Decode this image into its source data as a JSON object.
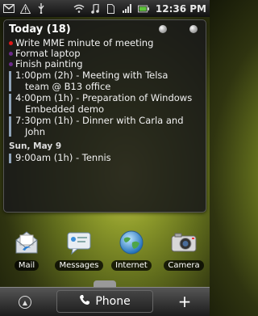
{
  "status_bar": {
    "left_icons": [
      "gmail-icon",
      "alert-icon",
      "usb-icon"
    ],
    "right_icons": [
      "wifi-icon",
      "music-icon",
      "sim-icon",
      "signal-icon",
      "battery-icon"
    ],
    "time": "12:36 PM"
  },
  "agenda_widget": {
    "title": "Today (18)",
    "tasks": [
      {
        "text": "Write MME minute of meeting",
        "color": "#e01818"
      },
      {
        "text": "Format laptop",
        "color": "#6a2a8a"
      },
      {
        "text": "Finish painting",
        "color": "#6a2a8a"
      }
    ],
    "events_today": [
      {
        "line1": "1:00pm (2h) - Meeting with Telsa",
        "line2": "team @ B13 office"
      },
      {
        "line1": "4:00pm (1h) - Preparation of Windows",
        "line2": "Embedded demo"
      },
      {
        "line1": "7:30pm (1h) - Dinner with Carla and",
        "line2": "John"
      }
    ],
    "day_header": "Sun, May 9",
    "events_next": [
      {
        "line1": "9:00am (1h) - Tennis"
      }
    ]
  },
  "apps": [
    {
      "label": "Mail",
      "icon": "mail-icon"
    },
    {
      "label": "Messages",
      "icon": "messages-icon"
    },
    {
      "label": "Internet",
      "icon": "globe-icon"
    },
    {
      "label": "Camera",
      "icon": "camera-icon"
    }
  ],
  "dock": {
    "phone_label": "Phone",
    "left_icon": "app-drawer-icon",
    "right_icon": "plus-icon"
  }
}
